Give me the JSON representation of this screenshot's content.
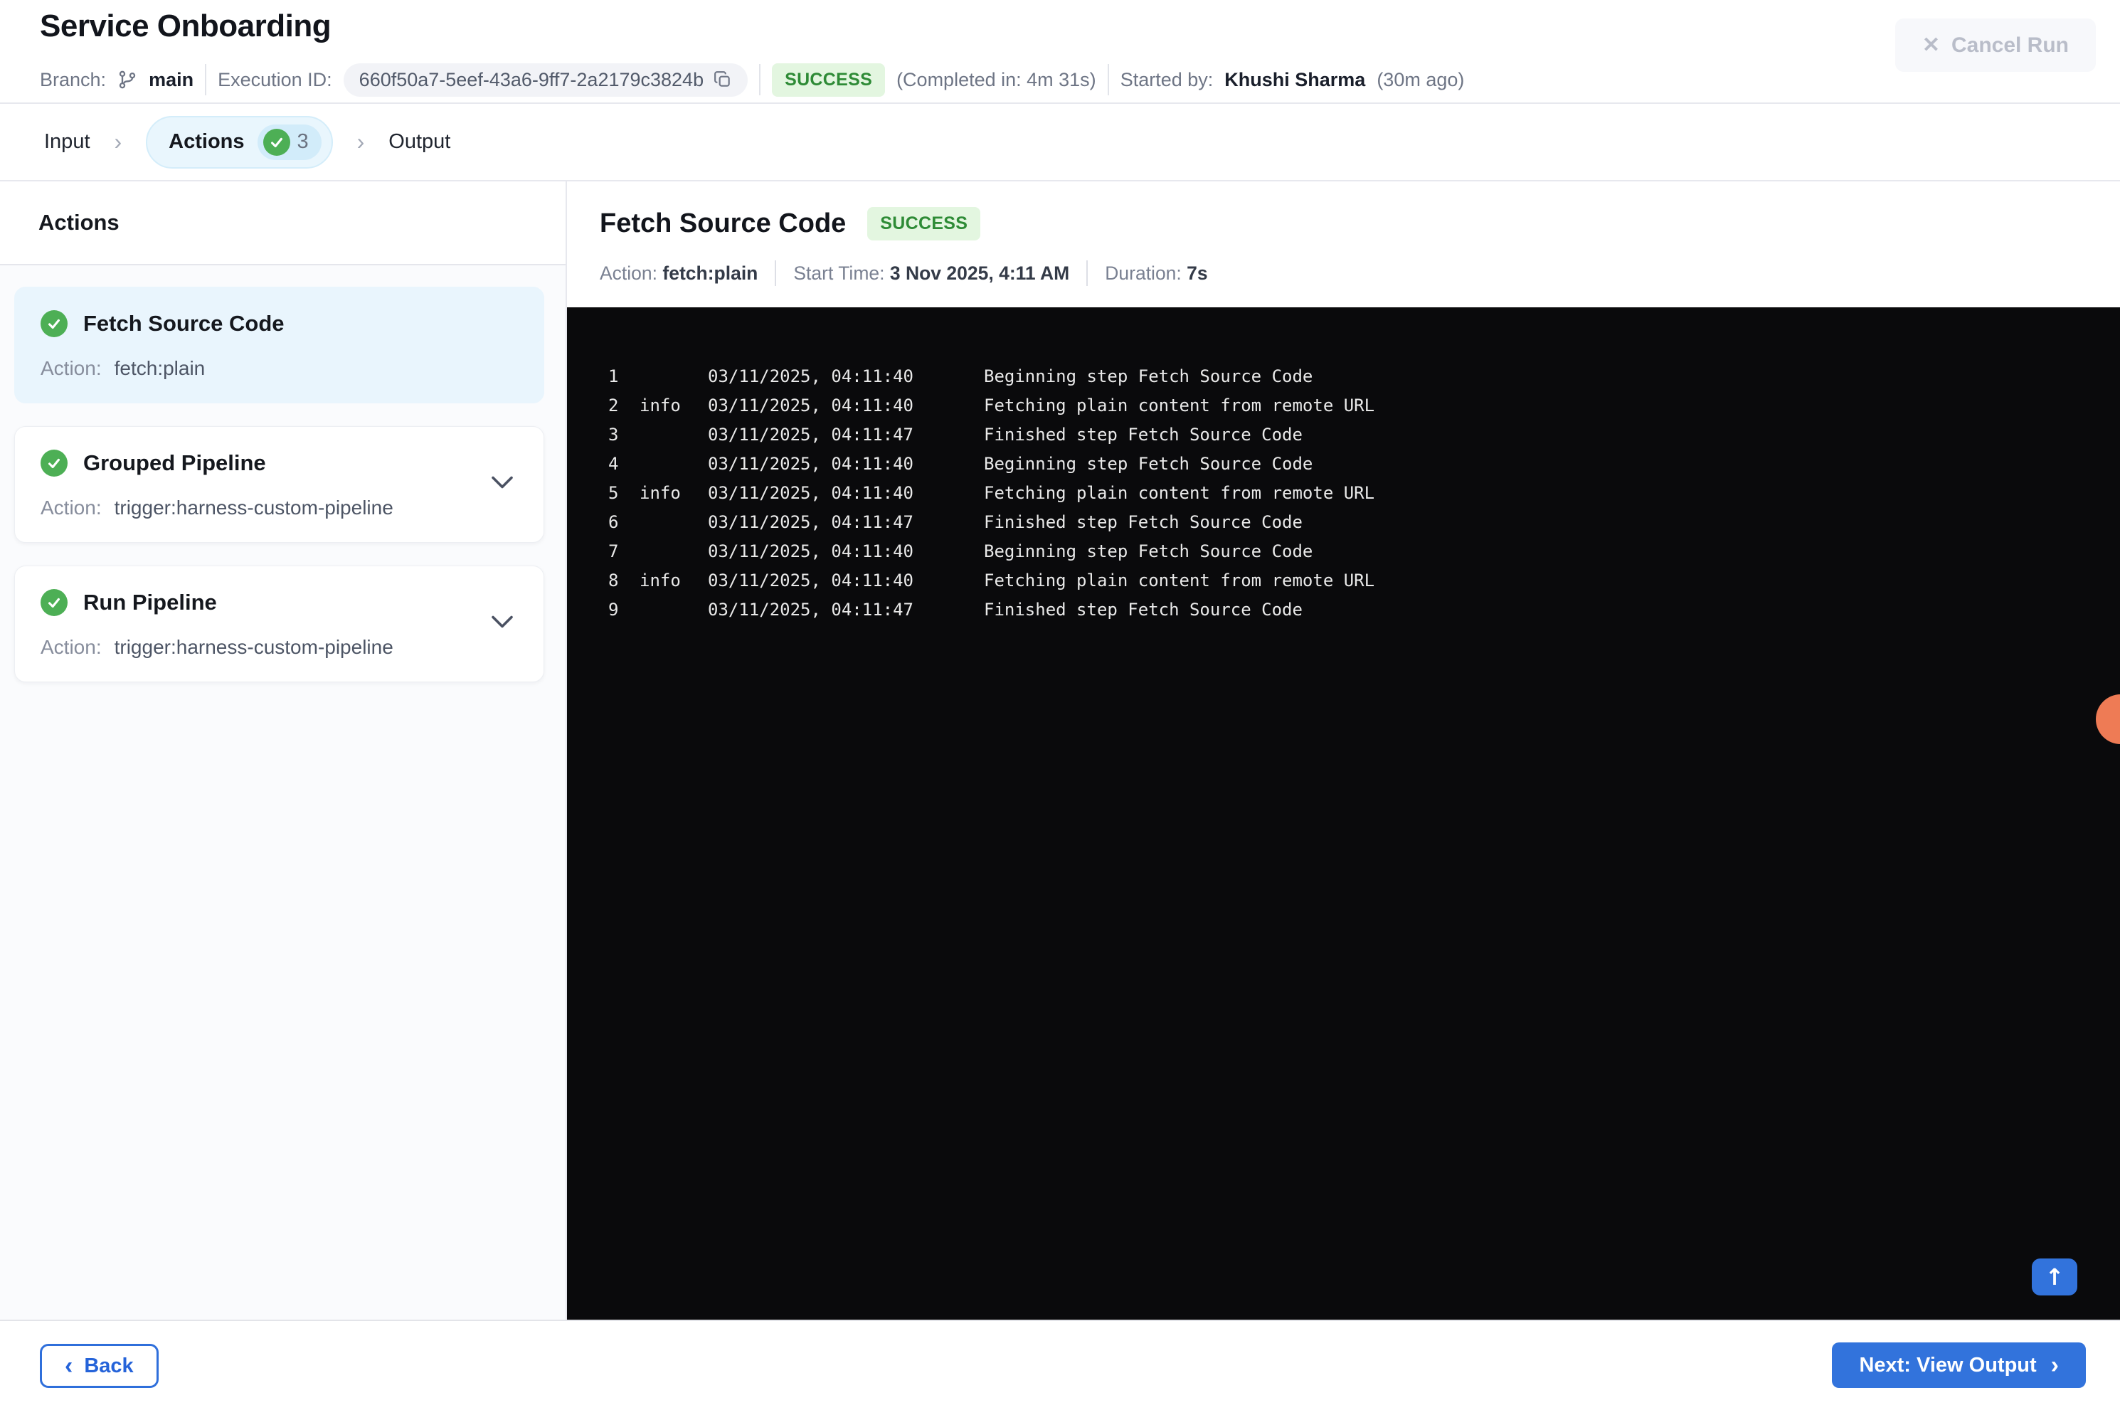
{
  "header": {
    "title": "Service Onboarding",
    "branch_label": "Branch:",
    "branch": "main",
    "execution_id_label": "Execution ID:",
    "execution_id": "660f50a7-5eef-43a6-9ff7-2a2179c3824b",
    "status": "SUCCESS",
    "completed_in": "(Completed in: 4m 31s)",
    "started_by_label": "Started by:",
    "started_by": "Khushi Sharma",
    "started_ago": "(30m ago)",
    "cancel_button": "Cancel Run"
  },
  "tabs": [
    {
      "label": "Input",
      "active": false
    },
    {
      "label": "Actions",
      "active": true,
      "count": "3"
    },
    {
      "label": "Output",
      "active": false
    }
  ],
  "sidebar": {
    "title": "Actions",
    "items": [
      {
        "title": "Fetch Source Code",
        "action_label": "Action:",
        "action": "fetch:plain",
        "status": "success",
        "selected": true,
        "expandable": false
      },
      {
        "title": "Grouped Pipeline",
        "action_label": "Action:",
        "action": "trigger:harness-custom-pipeline",
        "status": "success",
        "selected": false,
        "expandable": true
      },
      {
        "title": "Run Pipeline",
        "action_label": "Action:",
        "action": "trigger:harness-custom-pipeline",
        "status": "success",
        "selected": false,
        "expandable": true
      }
    ]
  },
  "detail": {
    "title": "Fetch Source Code",
    "status": "SUCCESS",
    "meta": [
      {
        "label": "Action:",
        "value": "fetch:plain"
      },
      {
        "label": "Start Time:",
        "value": "3 Nov 2025, 4:11 AM"
      },
      {
        "label": "Duration:",
        "value": "7s"
      }
    ],
    "logs": [
      {
        "num": "1",
        "level": "",
        "time": "03/11/2025, 04:11:40",
        "message": "Beginning step Fetch Source Code"
      },
      {
        "num": "2",
        "level": "info",
        "time": "03/11/2025, 04:11:40",
        "message": "Fetching plain content from remote URL"
      },
      {
        "num": "3",
        "level": "",
        "time": "03/11/2025, 04:11:47",
        "message": "Finished step Fetch Source Code"
      },
      {
        "num": "4",
        "level": "",
        "time": "03/11/2025, 04:11:40",
        "message": "Beginning step Fetch Source Code"
      },
      {
        "num": "5",
        "level": "info",
        "time": "03/11/2025, 04:11:40",
        "message": "Fetching plain content from remote URL"
      },
      {
        "num": "6",
        "level": "",
        "time": "03/11/2025, 04:11:47",
        "message": "Finished step Fetch Source Code"
      },
      {
        "num": "7",
        "level": "",
        "time": "03/11/2025, 04:11:40",
        "message": "Beginning step Fetch Source Code"
      },
      {
        "num": "8",
        "level": "info",
        "time": "03/11/2025, 04:11:40",
        "message": "Fetching plain content from remote URL"
      },
      {
        "num": "9",
        "level": "",
        "time": "03/11/2025, 04:11:47",
        "message": "Finished step Fetch Source Code"
      }
    ]
  },
  "footer": {
    "back_button": "Back",
    "next_button": "Next: View Output"
  },
  "icons": {
    "close": "✕",
    "breadcrumb_separator": "›",
    "back_chevron": "‹",
    "next_chevron": "›",
    "scroll_top_arrow": "↑"
  },
  "colors": {
    "accent_blue": "#3273dc",
    "success_green": "#4daf55",
    "success_badge_bg": "#e3f6e0",
    "success_badge_text": "#2e8b36",
    "active_tab_bg": "#e9f6fd",
    "selected_card_bg": "#e9f5fd",
    "console_bg": "#0a0a0c",
    "coral_dot": "#ee7b55"
  }
}
